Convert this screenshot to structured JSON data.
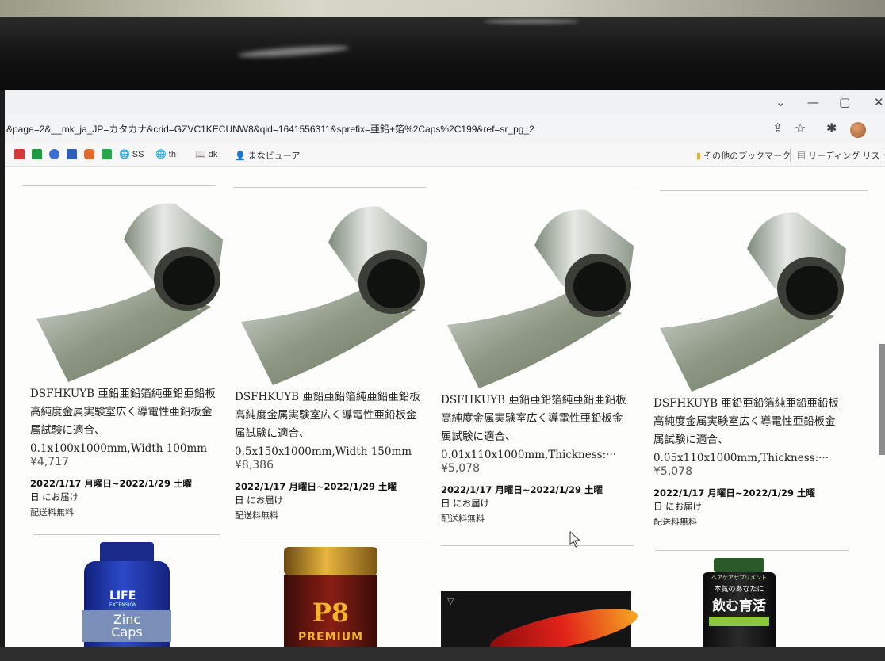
{
  "browser": {
    "url": "&page=2&__mk_ja_JP=カタカナ&crid=GZVC1KECUNW8&qid=1641556311&sprefix=亜鉛+箔%2Caps%2C199&ref=sr_pg_2"
  },
  "bookmarks": {
    "items": [
      {
        "label": "SS",
        "icon": "globe-icon"
      },
      {
        "label": "th",
        "icon": "globe-icon"
      },
      {
        "label": "dk",
        "icon": "book-icon"
      },
      {
        "label": "まなビューア",
        "icon": "person-icon"
      }
    ],
    "other_bookmarks": "その他のブックマーク",
    "reading_list": "リーディング リスト"
  },
  "products": [
    {
      "title_lines": [
        "DSFHKUYB 亜鉛亜鉛箔純亜鉛亜鉛板",
        "高純度金属実験室広く導電性亜鉛板金",
        "属試験に適合、",
        "0.1x100x1000mm,Width 100mm"
      ],
      "price": "¥4,717",
      "delivery_lines": [
        "2022/1/17 月曜日~2022/1/29 土曜",
        "日 にお届け"
      ],
      "shipping": "配送料無料"
    },
    {
      "title_lines": [
        "DSFHKUYB 亜鉛亜鉛箔純亜鉛亜鉛板",
        "高純度金属実験室広く導電性亜鉛板金",
        "属試験に適合、",
        "0.5x150x1000mm,Width 150mm"
      ],
      "price": "¥8,386",
      "delivery_lines": [
        "2022/1/17 月曜日~2022/1/29 土曜",
        "日 にお届け"
      ],
      "shipping": "配送料無料"
    },
    {
      "title_lines": [
        "DSFHKUYB 亜鉛亜鉛箔純亜鉛亜鉛板",
        "高純度金属実験室広く導電性亜鉛板金",
        "属試験に適合、",
        "0.01x110x1000mm,Thickness:···"
      ],
      "price": "¥5,078",
      "delivery_lines": [
        "2022/1/17 月曜日~2022/1/29 土曜",
        "日 にお届け"
      ],
      "shipping": "配送料無料"
    },
    {
      "title_lines": [
        "DSFHKUYB 亜鉛亜鉛箔純亜鉛亜鉛板",
        "高純度金属実験室広く導電性亜鉛板金",
        "属試験に適合、",
        "0.05x110x1000mm,Thickness:···"
      ],
      "price": "¥5,078",
      "delivery_lines": [
        "2022/1/17 月曜日~2022/1/29 土曜",
        "日 にお届け"
      ],
      "shipping": "配送料無料"
    }
  ],
  "bottom_products": {
    "life_extension": {
      "brand": "LIFE",
      "sub": "EXTENSION",
      "name1": "Zinc",
      "name2": "Caps"
    },
    "p8": {
      "label": "P8",
      "sub": "PREMIUM"
    },
    "supplement": {
      "top": "ヘアケアサプリメント",
      "line1": "本気のあなたに",
      "line2": "飲む育活"
    }
  }
}
